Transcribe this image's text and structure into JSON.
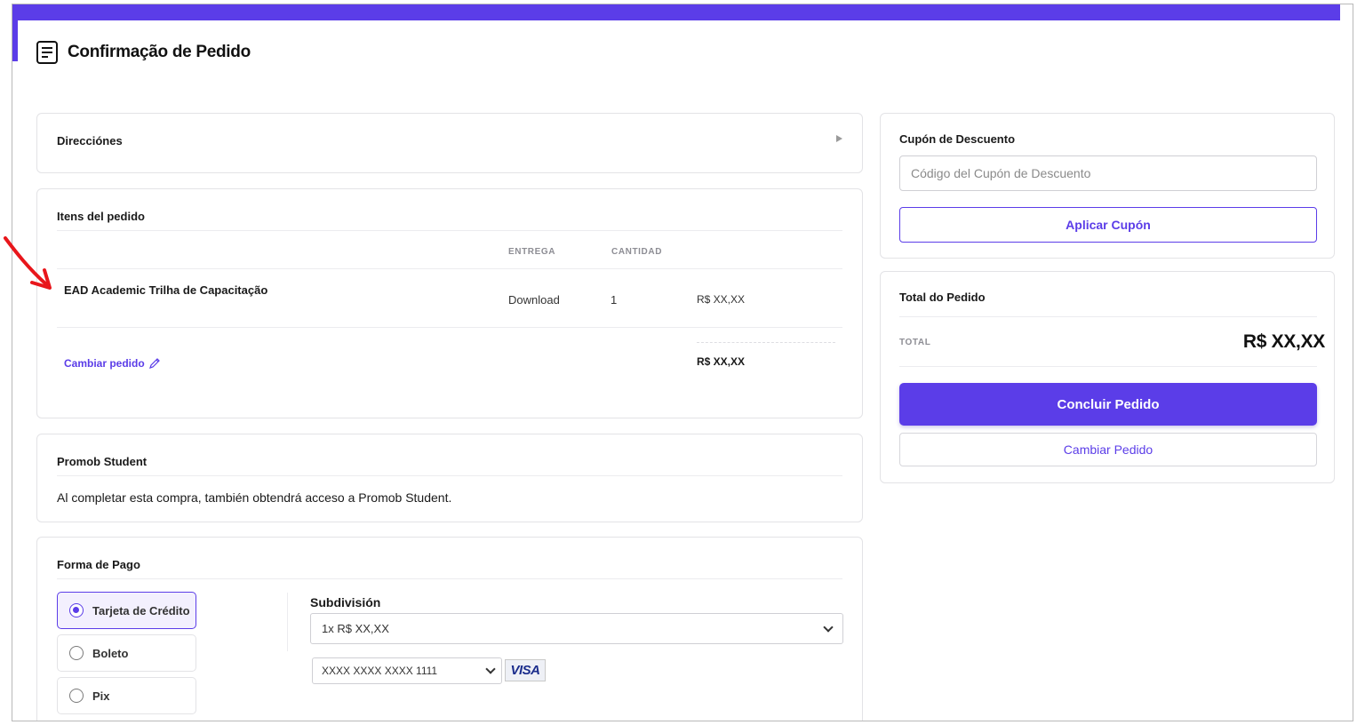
{
  "page": {
    "title": "Confirmação de Pedido"
  },
  "addresses": {
    "title": "Direcciónes"
  },
  "order_items": {
    "title": "Itens del pedido",
    "columns": {
      "delivery": "ENTREGA",
      "quantity": "CANTIDAD"
    },
    "items": [
      {
        "name": "EAD Academic Trilha de Capacitação",
        "delivery": "Download",
        "quantity": "1",
        "price": "R$ XX,XX"
      }
    ],
    "change_link": "Cambiar pedido",
    "subtotal": "R$ XX,XX"
  },
  "promob": {
    "title": "Promob Student",
    "description": "Al completar esta compra, también obtendrá acceso a Promob Student."
  },
  "payment": {
    "title": "Forma de Pago",
    "options": [
      {
        "label": "Tarjeta de Crédito",
        "selected": true
      },
      {
        "label": "Boleto",
        "selected": false
      },
      {
        "label": "Pix",
        "selected": false
      }
    ],
    "subdivision_label": "Subdivisión",
    "installment_value": "1x R$ XX,XX",
    "card_value": "XXXX XXXX XXXX 1111",
    "card_brand": "VISA"
  },
  "coupon": {
    "title": "Cupón de Descuento",
    "placeholder": "Código del Cupón de Descuento",
    "apply_label": "Aplicar Cupón"
  },
  "order_total": {
    "title": "Total do Pedido",
    "total_label": "TOTAL",
    "total_value": "R$ XX,XX",
    "conclude_label": "Concluir Pedido",
    "change_label": "Cambiar Pedido"
  },
  "colors": {
    "accent": "#5b3de8",
    "annotation_arrow": "#e8161b"
  }
}
